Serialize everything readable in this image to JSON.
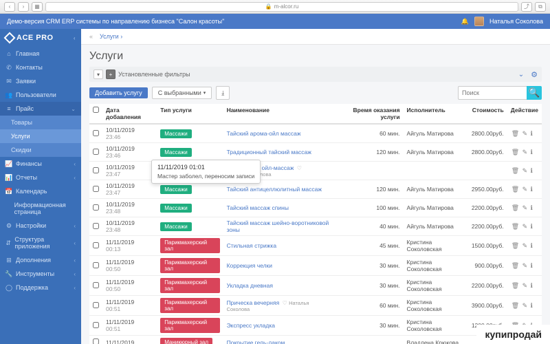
{
  "browser": {
    "url": "m-alcor.ru"
  },
  "banner": {
    "title": "Демо-версия CRM ERP системы по направлению бизнеса \"Салон красоты\"",
    "user": "Наталья Соколова"
  },
  "brand": "ACE PRO",
  "sidebar": [
    {
      "icon": "⌂",
      "label": "Главная"
    },
    {
      "icon": "✆",
      "label": "Контакты"
    },
    {
      "icon": "✉",
      "label": "Заявки"
    },
    {
      "icon": "👥",
      "label": "Пользователи"
    },
    {
      "icon": "≡",
      "label": "Прайс",
      "open": true,
      "children": [
        {
          "label": "Товары"
        },
        {
          "label": "Услуги",
          "current": true
        },
        {
          "label": "Скидки"
        }
      ]
    },
    {
      "icon": "📈",
      "label": "Финансы",
      "ch": "‹"
    },
    {
      "icon": "📊",
      "label": "Отчеты",
      "ch": "‹"
    },
    {
      "icon": "📅",
      "label": "Календарь"
    },
    {
      "icon": " ",
      "label": "Информационная страница"
    },
    {
      "icon": "⚙",
      "label": "Настройки",
      "ch": "‹"
    },
    {
      "icon": "⇵",
      "label": "Структура приложения",
      "ch": "‹"
    },
    {
      "icon": "⊞",
      "label": "Дополнения",
      "ch": "‹"
    },
    {
      "icon": "🔧",
      "label": "Инструменты",
      "ch": "‹"
    },
    {
      "icon": "◯",
      "label": "Поддержка",
      "ch": "‹"
    }
  ],
  "breadcrumb": "Услуги  ›",
  "page_title": "Услуги",
  "filters_label": "Установленные фильтры",
  "toolbar": {
    "add": "Добавить услугу",
    "selected": "С выбранными",
    "search_ph": "Поиск"
  },
  "columns": {
    "c0": "",
    "c1": "Дата добавления",
    "c2": "Тип услуги",
    "c3": "Наименование",
    "c4": "Время оказания услуги",
    "c5": "Исполнитель",
    "c6": "Стоимость",
    "c7": "Действие"
  },
  "tooltip": {
    "date": "11/11/2019 01:01",
    "body": "Мастер заболел, переносим записи"
  },
  "rows": [
    {
      "date": "10/11/2019",
      "time": "23:46",
      "type": "Массажи",
      "typec": "green",
      "name": "Тайский арома-ойл массаж",
      "dur": "60 мин.",
      "exec": "Айгуль Матирова",
      "price": "2800.00руб."
    },
    {
      "date": "10/11/2019",
      "time": "23:46",
      "type": "Массажи",
      "typec": "green",
      "name": "Традиционный тайский массаж",
      "dur": "120 мин.",
      "exec": "Айгуль Матирова",
      "price": "2800.00руб."
    },
    {
      "date": "10/11/2019",
      "time": "23:47",
      "type": "Массажи",
      "typec": "green",
      "name": "Спортивный ойл-массаж",
      "sub": "Наталья Соколова",
      "dur": "",
      "exec": "",
      "price": "",
      "heart": true
    },
    {
      "date": "10/11/2019",
      "time": "23:47",
      "type": "Массажи",
      "typec": "green",
      "name": "Тайский антицеллюлитный массаж",
      "dur": "120 мин.",
      "exec": "Айгуль Матирова",
      "price": "2950.00руб."
    },
    {
      "date": "10/11/2019",
      "time": "23:48",
      "type": "Массажи",
      "typec": "green",
      "name": "Тайский массаж спины",
      "dur": "100 мин.",
      "exec": "Айгуль Матирова",
      "price": "2200.00руб."
    },
    {
      "date": "10/11/2019",
      "time": "23:48",
      "type": "Массажи",
      "typec": "green",
      "name": "Тайский массаж шейно-воротниковой зоны",
      "dur": "40 мин.",
      "exec": "Айгуль Матирова",
      "price": "2200.00руб."
    },
    {
      "date": "11/11/2019",
      "time": "00:13",
      "type": "Парикмахерский зал",
      "typec": "red",
      "name": "Стильная стрижка",
      "dur": "45 мин.",
      "exec": "Кристина Соколовская",
      "price": "1500.00руб."
    },
    {
      "date": "11/11/2019",
      "time": "00:50",
      "type": "Парикмахерский зал",
      "typec": "red",
      "name": "Коррекция челки",
      "dur": "30 мин.",
      "exec": "Кристина Соколовская",
      "price": "900.00руб."
    },
    {
      "date": "11/11/2019",
      "time": "00:50",
      "type": "Парикмахерский зал",
      "typec": "red",
      "name": "Укладка дневная",
      "dur": "30 мин.",
      "exec": "Кристина Соколовская",
      "price": "2200.00руб."
    },
    {
      "date": "11/11/2019",
      "time": "00:51",
      "type": "Парикмахерский зал",
      "typec": "red",
      "name": "Прическа вечерняя",
      "sub": "Соколова",
      "dur": "60 мин.",
      "exec": "Кристина Соколовская",
      "price": "3900.00руб.",
      "heart": true,
      "heartlabel": "Наталья"
    },
    {
      "date": "11/11/2019",
      "time": "00:51",
      "type": "Парикмахерский зал",
      "typec": "red",
      "name": "Экспресс укладка",
      "dur": "30 мин.",
      "exec": "Кристина Соколовская",
      "price": "1200.00руб."
    },
    {
      "date": "11/11/2019",
      "time": "",
      "type": "Маникюрный зал",
      "typec": "red",
      "name": "Покрытие гель-лаком",
      "dur": "",
      "exec": "Владлена Крюкова",
      "price": ""
    }
  ],
  "watermark": "купипродай"
}
